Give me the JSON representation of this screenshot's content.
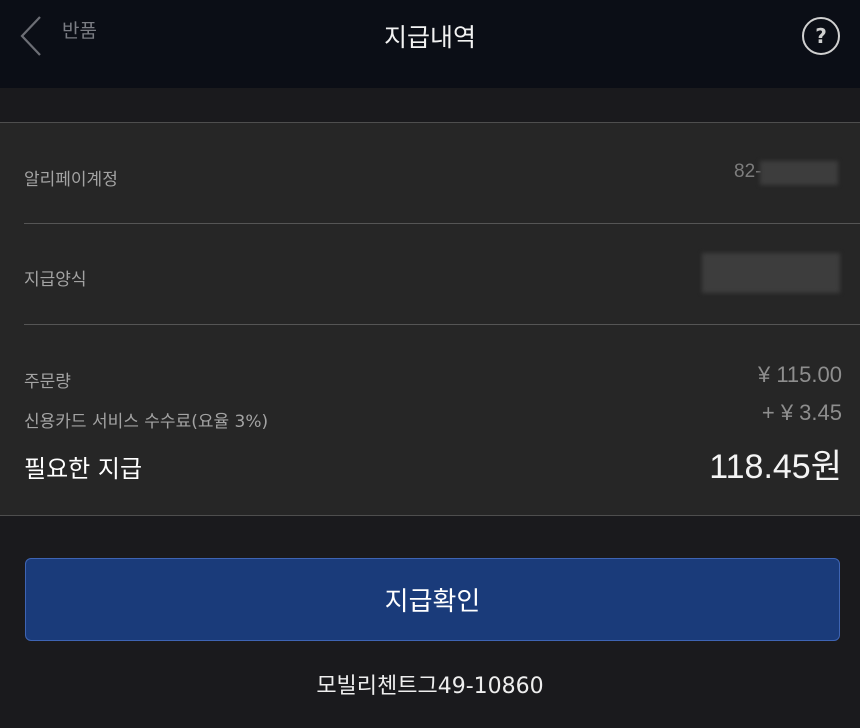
{
  "header": {
    "back_label": "반품",
    "title": "지급내역",
    "help_symbol": "?"
  },
  "details": {
    "account_label": "알리페이계정",
    "account_value": "82-",
    "method_label": "지급양식",
    "order_label": "주문량",
    "order_amount": "¥ 115.00",
    "fee_label": "신용카드 서비스 수수료(요율 3%)",
    "fee_amount": "+ ¥ 3.45",
    "total_label": "필요한 지급",
    "total_amount": "118.45원"
  },
  "confirm_label": "지급확인",
  "footer_text": "모빌리첸트그49-10860",
  "colors": {
    "header_bg": "#0b0e16",
    "page_bg": "#1a1a1d",
    "panel_bg": "#262626",
    "button_bg": "#1a3b7a"
  },
  "icons": {
    "back": "chevron-left-icon",
    "help": "question-circle-icon"
  }
}
